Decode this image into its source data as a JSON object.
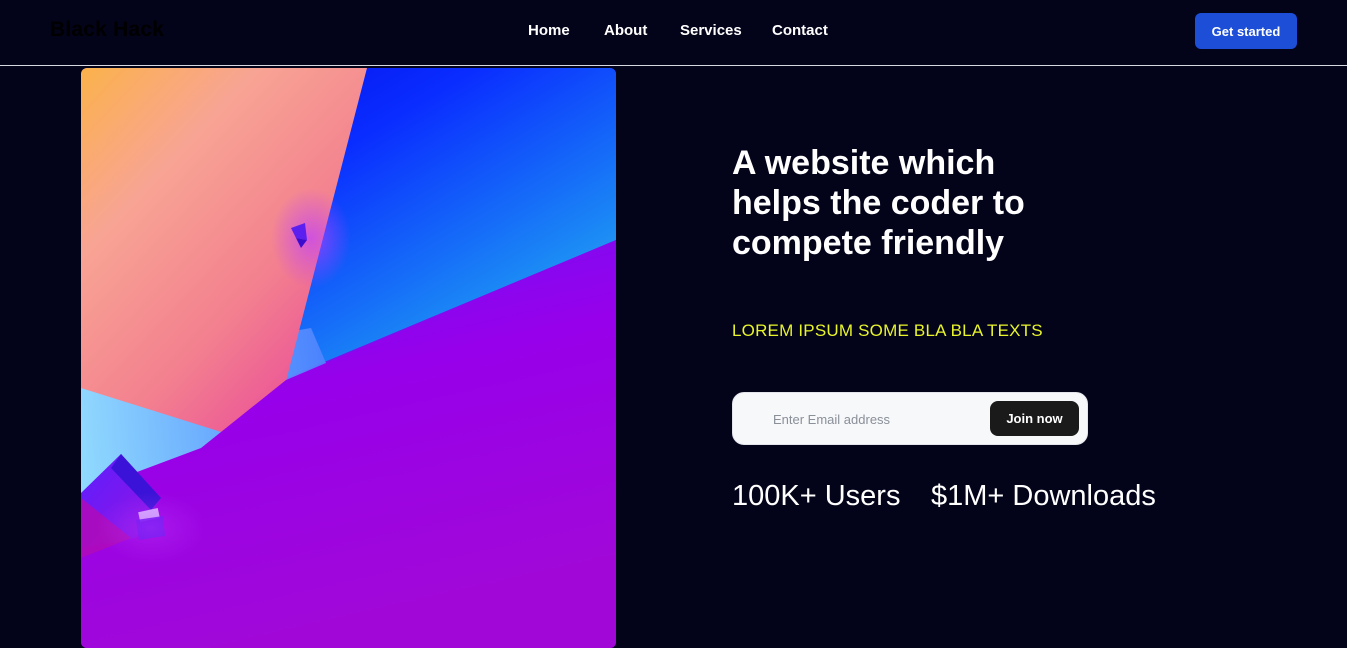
{
  "navbar": {
    "brand": "Black Hack",
    "links": [
      "Home",
      "About",
      "Services",
      "Contact"
    ],
    "cta_label": "Get started"
  },
  "hero": {
    "headline": "A website which helps the coder to compete friendly",
    "subtitle": "LOREM IPSUM SOME BLA BLA TEXTS",
    "email_placeholder": "Enter Email address",
    "email_value": "",
    "join_label": "Join now",
    "stats": [
      "100K+ Users",
      "$1M+ Downloads"
    ]
  },
  "colors": {
    "background": "#03031a",
    "accent": "#1d4ed8",
    "subtitle": "#e8f52a"
  }
}
